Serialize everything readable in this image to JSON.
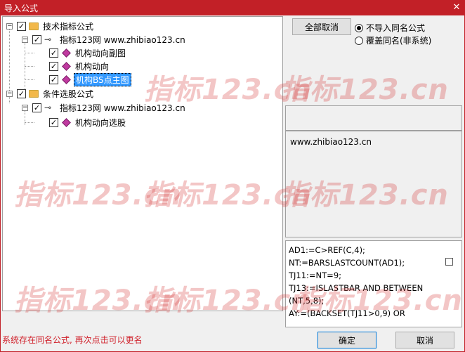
{
  "window": {
    "title": "导入公式",
    "close_glyph": "✕"
  },
  "tree": {
    "expander_glyph": "−",
    "check_glyph": "✓",
    "nodes": [
      {
        "label": "技术指标公式"
      },
      {
        "label": "指标123网 www.zhibiao123.cn"
      },
      {
        "label": "机构动向副图"
      },
      {
        "label": "机构动向"
      },
      {
        "label": "机构BS点主图",
        "selected": true
      },
      {
        "label": "条件选股公式"
      },
      {
        "label": "指标123网 www.zhibiao123.cn"
      },
      {
        "label": "机构动向选股"
      }
    ]
  },
  "buttons": {
    "cancel_all": "全部取消",
    "ok": "确定",
    "cancel": "取消"
  },
  "options": {
    "no_import_same": "不导入同名公式",
    "overwrite_same": "覆盖同名(非系统)",
    "selected": "no_import_same"
  },
  "description": "www.zhibiao123.cn",
  "code_lines": [
    "AD1:=C>REF(C,4);",
    "NT:=BARSLASTCOUNT(AD1);",
    "TJ11:=NT=9;",
    "TJ13:=ISLASTBAR AND BETWEEN",
    "(NT,5,8);",
    "AY:=(BACKSET(TJ11>0,9) OR"
  ],
  "status_message": "系统存在同名公式, 再次点击可以更名",
  "watermark": "指标123.cn",
  "colors": {
    "title_bar": "#c22027",
    "status_text": "#d0202a",
    "selection": "#3399ff"
  }
}
